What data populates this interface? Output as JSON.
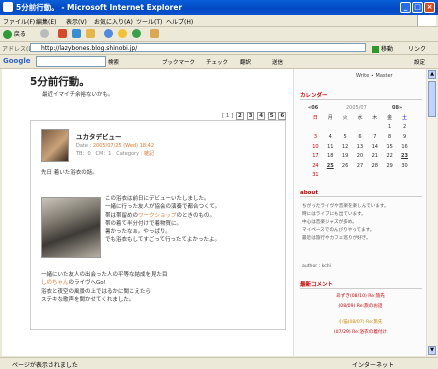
{
  "window": {
    "title": "5分前行動。 - Microsoft Internet Explorer"
  },
  "menu": [
    "ファイル(F)",
    "編集(E)",
    "表示(V)",
    "お気に入り(A)",
    "ツール(T)",
    "ヘルプ(H)"
  ],
  "toolbar": {
    "back": "戻る"
  },
  "address": {
    "label": "アドレス(D)",
    "url": "http://lazybones.blog.shinobi.jp/",
    "go": "移動",
    "links": "リンク"
  },
  "googlebar": {
    "logo": "Google",
    "search": "検索",
    "bookmarks": "ブックマーク",
    "check": "チェック",
    "translate": "翻訳",
    "send": "送信",
    "settings": "設定"
  },
  "blog": {
    "title": "5分前行動。",
    "tagline": "最近イマイチ余裕ないかも。",
    "pager_label": "[ 1 ]",
    "pages": [
      "2",
      "3",
      "4",
      "5",
      "6"
    ]
  },
  "entry": {
    "title": "ユカタデビュー",
    "date_label": "Date",
    "date": "2005/07/25 (Wed) 18:42",
    "tb": "TB：0",
    "cm": "CM：1",
    "category_label": "Category",
    "category": "雑記",
    "intro": "先日 着いた浴衣の話。",
    "lines": [
      "この浴衣は前日にデビューいたしました。",
      "一緒に行った友人が協会の演奏で都合つくて。",
      "帯は帯留めの",
      "ワークショップ",
      "のときのもの。",
      "帯の着て半分付けで着物買に。",
      "暑かったなぁ。やっぱり。",
      "でも浴衣もしてすごって行ったてよかったよ。"
    ],
    "closing": [
      "一緒にいた友人の出会った人の平等な結成を見た目",
      "しのちゃん",
      "のライヴへGo!",
      "浴衣と夜空の風景の上ではるかに聞こえたら",
      "ステキな歌声を聞かせてくれました。"
    ]
  },
  "sidebar": {
    "top_links": "Write ∙ Master",
    "calendar_head": "カレンダー",
    "cal_nav_prev": "«06",
    "cal_month": "2005/07",
    "cal_nav_next": "08»",
    "weekdays": [
      "日",
      "月",
      "火",
      "水",
      "木",
      "金",
      "土"
    ],
    "weeks": [
      [
        "",
        "",
        "",
        "",
        "",
        "1",
        "2"
      ],
      [
        "3",
        "4",
        "5",
        "6",
        "7",
        "8",
        "9"
      ],
      [
        "10",
        "11",
        "12",
        "13",
        "14",
        "15",
        "16"
      ],
      [
        "17",
        "18",
        "19",
        "20",
        "21",
        "22",
        "23"
      ],
      [
        "24",
        "25",
        "26",
        "27",
        "28",
        "29",
        "30"
      ],
      [
        "31",
        "",
        "",
        "",
        "",
        "",
        ""
      ]
    ],
    "about_head": "about",
    "about_lines": [
      "ちがったライヴや音楽を楽しんでいます。",
      "時にはライブにも出ています。",
      "中心は音楽ジャズが多め。",
      "マイペースでのんびりやってます。",
      "最近は旅行やカフェ巡りが好き。"
    ],
    "author": "author : kchi",
    "reply_head": "最新コメント",
    "replies": [
      {
        "name": "あずき",
        "text": "(08/10) Re:旅先",
        "color": "#d00000"
      },
      {
        "name": "",
        "text": "(08/09) Re:旅のお話",
        "color": "#d00000"
      },
      {
        "name": "小猫",
        "text": "(08/07) Re:旅先",
        "color": "#cc8800"
      },
      {
        "name": "",
        "text": "(07/29) Re:浴衣の着付け",
        "color": "#d00000"
      }
    ]
  },
  "status": {
    "text": "ページが表示されました",
    "zone": "インターネット"
  }
}
